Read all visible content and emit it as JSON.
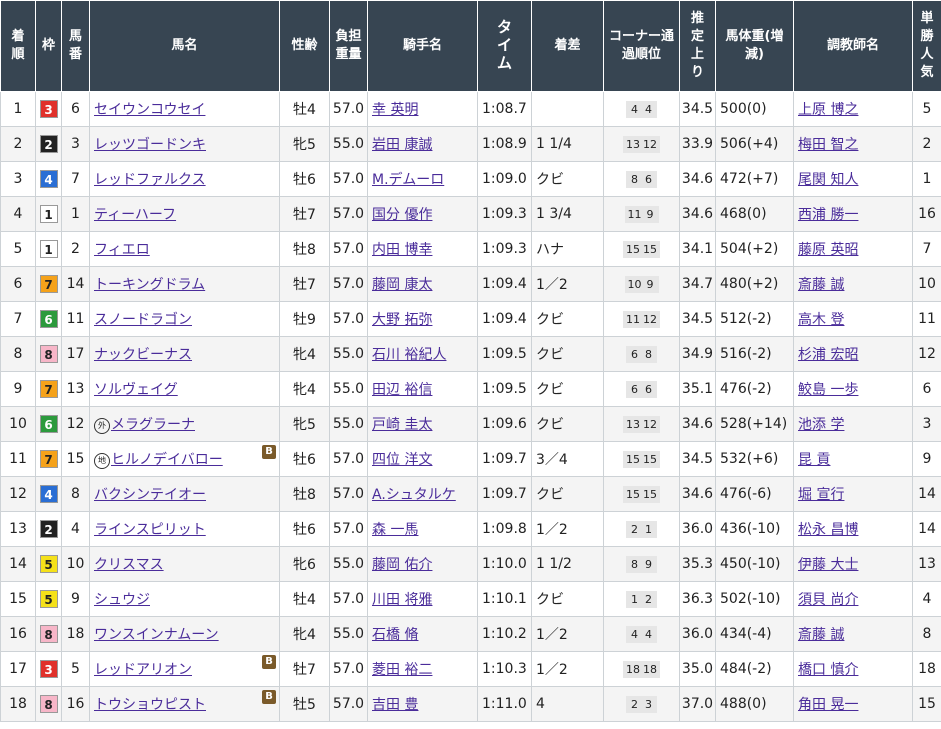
{
  "headers": {
    "rank": "着順",
    "waku": "枠",
    "num": "馬番",
    "horse": "馬名",
    "sexage": "性齢",
    "weight": "負担重量",
    "jockey": "騎手名",
    "time": "タイム",
    "margin": "着差",
    "corner": "コーナー通過順位",
    "last3f": "推定上り",
    "body": "馬体重(増減)",
    "trainer": "調教師名",
    "pop": "単勝人気"
  },
  "waku_colors": {
    "1": {
      "bg": "#ffffff",
      "fg": "#222222"
    },
    "2": {
      "bg": "#222222",
      "fg": "#ffffff"
    },
    "3": {
      "bg": "#e0312b",
      "fg": "#ffffff"
    },
    "4": {
      "bg": "#2a6ed4",
      "fg": "#ffffff"
    },
    "5": {
      "bg": "#f5e11a",
      "fg": "#222222"
    },
    "6": {
      "bg": "#2c9a3d",
      "fg": "#ffffff"
    },
    "7": {
      "bg": "#f5a21a",
      "fg": "#222222"
    },
    "8": {
      "bg": "#f7b6c8",
      "fg": "#222222"
    }
  },
  "rows": [
    {
      "rank": "1",
      "waku": "3",
      "num": "6",
      "mark": "",
      "horse": "セイウンコウセイ",
      "blinker": "",
      "sexage": "牡4",
      "weight": "57.0",
      "jockey": "幸 英明",
      "time": "1:08.7",
      "margin": "",
      "corner": [
        "4",
        "4"
      ],
      "last3f": "34.5",
      "body": "500(0)",
      "trainer": "上原 博之",
      "pop": "5"
    },
    {
      "rank": "2",
      "waku": "2",
      "num": "3",
      "mark": "",
      "horse": "レッツゴードンキ",
      "blinker": "",
      "sexage": "牝5",
      "weight": "55.0",
      "jockey": "岩田 康誠",
      "time": "1:08.9",
      "margin": "1 1/4",
      "corner": [
        "13",
        "12"
      ],
      "last3f": "33.9",
      "body": "506(+4)",
      "trainer": "梅田 智之",
      "pop": "2"
    },
    {
      "rank": "3",
      "waku": "4",
      "num": "7",
      "mark": "",
      "horse": "レッドファルクス",
      "blinker": "",
      "sexage": "牡6",
      "weight": "57.0",
      "jockey": "M.デムーロ",
      "time": "1:09.0",
      "margin": "クビ",
      "corner": [
        "8",
        "6"
      ],
      "last3f": "34.6",
      "body": "472(+7)",
      "trainer": "尾関 知人",
      "pop": "1"
    },
    {
      "rank": "4",
      "waku": "1",
      "num": "1",
      "mark": "",
      "horse": "ティーハーフ",
      "blinker": "",
      "sexage": "牡7",
      "weight": "57.0",
      "jockey": "国分 優作",
      "time": "1:09.3",
      "margin": "1 3/4",
      "corner": [
        "11",
        "9"
      ],
      "last3f": "34.6",
      "body": "468(0)",
      "trainer": "西浦 勝一",
      "pop": "16"
    },
    {
      "rank": "5",
      "waku": "1",
      "num": "2",
      "mark": "",
      "horse": "フィエロ",
      "blinker": "",
      "sexage": "牡8",
      "weight": "57.0",
      "jockey": "内田 博幸",
      "time": "1:09.3",
      "margin": "ハナ",
      "corner": [
        "15",
        "15"
      ],
      "last3f": "34.1",
      "body": "504(+2)",
      "trainer": "藤原 英昭",
      "pop": "7"
    },
    {
      "rank": "6",
      "waku": "7",
      "num": "14",
      "mark": "",
      "horse": "トーキングドラム",
      "blinker": "",
      "sexage": "牡7",
      "weight": "57.0",
      "jockey": "藤岡 康太",
      "time": "1:09.4",
      "margin": "1／2",
      "corner": [
        "10",
        "9"
      ],
      "last3f": "34.7",
      "body": "480(+2)",
      "trainer": "斎藤 誠",
      "pop": "10"
    },
    {
      "rank": "7",
      "waku": "6",
      "num": "11",
      "mark": "",
      "horse": "スノードラゴン",
      "blinker": "",
      "sexage": "牡9",
      "weight": "57.0",
      "jockey": "大野 拓弥",
      "time": "1:09.4",
      "margin": "クビ",
      "corner": [
        "11",
        "12"
      ],
      "last3f": "34.5",
      "body": "512(-2)",
      "trainer": "高木 登",
      "pop": "11"
    },
    {
      "rank": "8",
      "waku": "8",
      "num": "17",
      "mark": "",
      "horse": "ナックビーナス",
      "blinker": "",
      "sexage": "牝4",
      "weight": "55.0",
      "jockey": "石川 裕紀人",
      "time": "1:09.5",
      "margin": "クビ",
      "corner": [
        "6",
        "8"
      ],
      "last3f": "34.9",
      "body": "516(-2)",
      "trainer": "杉浦 宏昭",
      "pop": "12"
    },
    {
      "rank": "9",
      "waku": "7",
      "num": "13",
      "mark": "",
      "horse": "ソルヴェイグ",
      "blinker": "",
      "sexage": "牝4",
      "weight": "55.0",
      "jockey": "田辺 裕信",
      "time": "1:09.5",
      "margin": "クビ",
      "corner": [
        "6",
        "6"
      ],
      "last3f": "35.1",
      "body": "476(-2)",
      "trainer": "鮫島 一歩",
      "pop": "6"
    },
    {
      "rank": "10",
      "waku": "6",
      "num": "12",
      "mark": "外",
      "horse": "メラグラーナ",
      "blinker": "",
      "sexage": "牝5",
      "weight": "55.0",
      "jockey": "戸崎 圭太",
      "time": "1:09.6",
      "margin": "クビ",
      "corner": [
        "13",
        "12"
      ],
      "last3f": "34.6",
      "body": "528(+14)",
      "trainer": "池添 学",
      "pop": "3"
    },
    {
      "rank": "11",
      "waku": "7",
      "num": "15",
      "mark": "地",
      "horse": "ヒルノデイバロー",
      "blinker": "B",
      "sexage": "牡6",
      "weight": "57.0",
      "jockey": "四位 洋文",
      "time": "1:09.7",
      "margin": "3／4",
      "corner": [
        "15",
        "15"
      ],
      "last3f": "34.5",
      "body": "532(+6)",
      "trainer": "昆 貢",
      "pop": "9"
    },
    {
      "rank": "12",
      "waku": "4",
      "num": "8",
      "mark": "",
      "horse": "バクシンテイオー",
      "blinker": "",
      "sexage": "牡8",
      "weight": "57.0",
      "jockey": "A.シュタルケ",
      "time": "1:09.7",
      "margin": "クビ",
      "corner": [
        "15",
        "15"
      ],
      "last3f": "34.6",
      "body": "476(-6)",
      "trainer": "堀 宣行",
      "pop": "14"
    },
    {
      "rank": "13",
      "waku": "2",
      "num": "4",
      "mark": "",
      "horse": "ラインスピリット",
      "blinker": "",
      "sexage": "牡6",
      "weight": "57.0",
      "jockey": "森 一馬",
      "time": "1:09.8",
      "margin": "1／2",
      "corner": [
        "2",
        "1"
      ],
      "last3f": "36.0",
      "body": "436(-10)",
      "trainer": "松永 昌博",
      "pop": "14"
    },
    {
      "rank": "14",
      "waku": "5",
      "num": "10",
      "mark": "",
      "horse": "クリスマス",
      "blinker": "",
      "sexage": "牝6",
      "weight": "55.0",
      "jockey": "藤岡 佑介",
      "time": "1:10.0",
      "margin": "1 1/2",
      "corner": [
        "8",
        "9"
      ],
      "last3f": "35.3",
      "body": "450(-10)",
      "trainer": "伊藤 大士",
      "pop": "13"
    },
    {
      "rank": "15",
      "waku": "5",
      "num": "9",
      "mark": "",
      "horse": "シュウジ",
      "blinker": "",
      "sexage": "牡4",
      "weight": "57.0",
      "jockey": "川田 将雅",
      "time": "1:10.1",
      "margin": "クビ",
      "corner": [
        "1",
        "2"
      ],
      "last3f": "36.3",
      "body": "502(-10)",
      "trainer": "須貝 尚介",
      "pop": "4"
    },
    {
      "rank": "16",
      "waku": "8",
      "num": "18",
      "mark": "",
      "horse": "ワンスインナムーン",
      "blinker": "",
      "sexage": "牝4",
      "weight": "55.0",
      "jockey": "石橋 脩",
      "time": "1:10.2",
      "margin": "1／2",
      "corner": [
        "4",
        "4"
      ],
      "last3f": "36.0",
      "body": "434(-4)",
      "trainer": "斎藤 誠",
      "pop": "8"
    },
    {
      "rank": "17",
      "waku": "3",
      "num": "5",
      "mark": "",
      "horse": "レッドアリオン",
      "blinker": "B",
      "sexage": "牡7",
      "weight": "57.0",
      "jockey": "菱田 裕二",
      "time": "1:10.3",
      "margin": "1／2",
      "corner": [
        "18",
        "18"
      ],
      "last3f": "35.0",
      "body": "484(-2)",
      "trainer": "橋口 慎介",
      "pop": "18"
    },
    {
      "rank": "18",
      "waku": "8",
      "num": "16",
      "mark": "",
      "horse": "トウショウピスト",
      "blinker": "B",
      "sexage": "牡5",
      "weight": "57.0",
      "jockey": "吉田 豊",
      "time": "1:11.0",
      "margin": "4",
      "corner": [
        "2",
        "3"
      ],
      "last3f": "37.0",
      "body": "488(0)",
      "trainer": "角田 晃一",
      "pop": "15"
    }
  ]
}
